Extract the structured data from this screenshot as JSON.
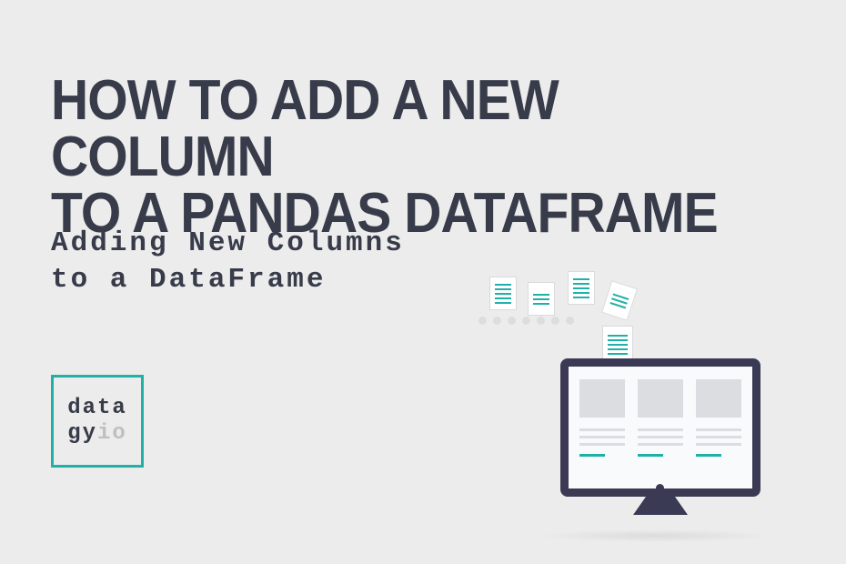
{
  "title_line1": "HOW TO ADD A NEW COLUMN",
  "title_line2": "TO A PANDAS DATAFRAME",
  "subtitle_line1": "Adding New Columns",
  "subtitle_line2": "to a DataFrame",
  "logo": {
    "line1": "data",
    "line2_a": "gy",
    "line2_b": "io"
  },
  "colors": {
    "background": "#ececec",
    "text_dark": "#383c4a",
    "accent_teal": "#1fb1a8",
    "monitor_frame": "#3a3a55",
    "logo_io_gray": "#bfbfbf"
  }
}
